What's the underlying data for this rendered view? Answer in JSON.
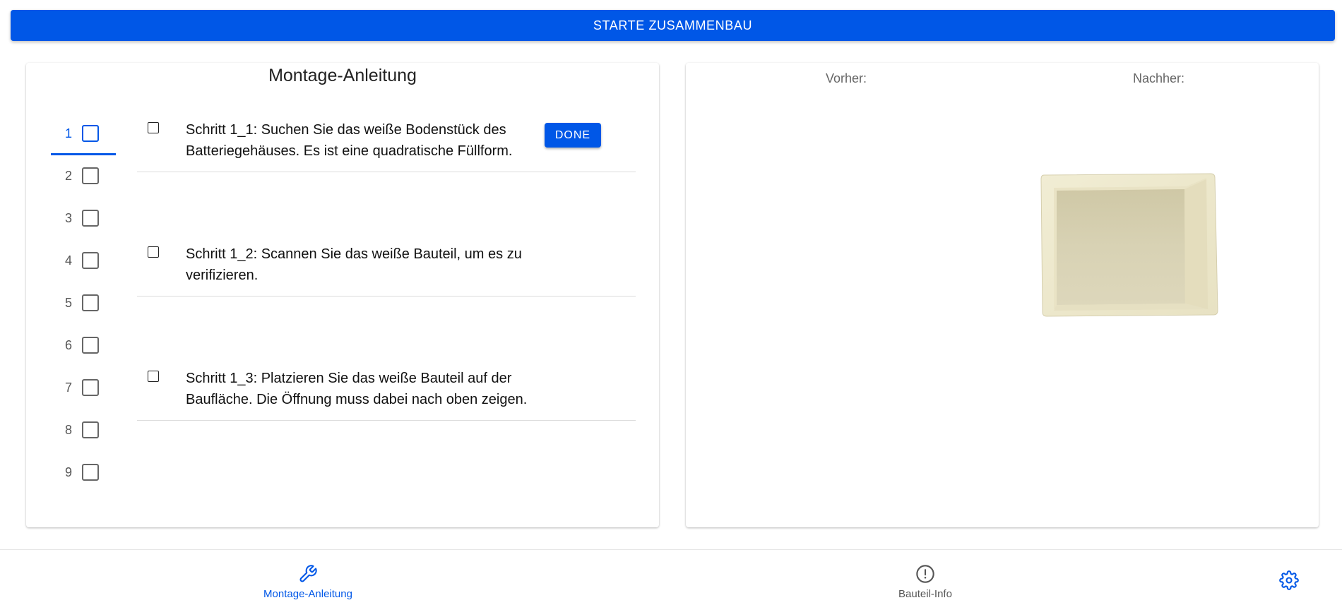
{
  "header": {
    "start_button_label": "STARTE ZUSAMMENBAU"
  },
  "instructions": {
    "title": "Montage-Anleitung",
    "step_nav": [
      {
        "label": "1",
        "active": true
      },
      {
        "label": "2",
        "active": false
      },
      {
        "label": "3",
        "active": false
      },
      {
        "label": "4",
        "active": false
      },
      {
        "label": "5",
        "active": false
      },
      {
        "label": "6",
        "active": false
      },
      {
        "label": "7",
        "active": false
      },
      {
        "label": "8",
        "active": false
      },
      {
        "label": "9",
        "active": false
      }
    ],
    "tasks": [
      {
        "text": "Schritt 1_1: Suchen Sie das weiße Bodenstück des Batteriegehäuses. Es ist eine quadratische Füllform.",
        "checked": false
      },
      {
        "text": "Schritt 1_2: Scannen Sie das weiße Bauteil, um es zu verifizieren.",
        "checked": false
      },
      {
        "text": "Schritt 1_3: Platzieren Sie das weiße Bauteil auf der Baufläche. Die Öffnung muss dabei nach oben zeigen.",
        "checked": false
      }
    ],
    "done_label": "DONE"
  },
  "preview": {
    "before_label": "Vorher:",
    "after_label": "Nachher:"
  },
  "bottom_nav": {
    "montage_label": "Montage-Anleitung",
    "bauteil_label": "Bauteil-Info"
  },
  "colors": {
    "accent": "#0057e7",
    "part_color": "#ece7c8"
  }
}
